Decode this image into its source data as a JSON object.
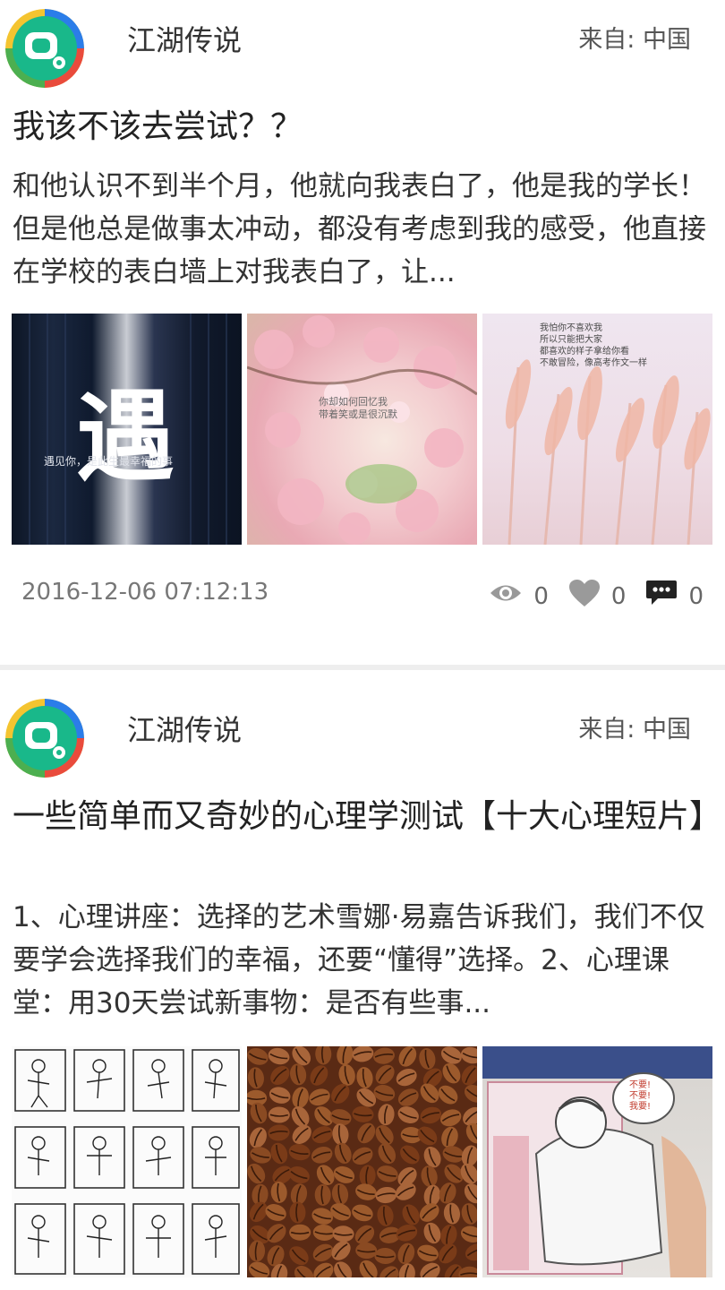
{
  "posts": [
    {
      "author": "江湖传说",
      "origin": "来自: 中国",
      "title": "我该不该去尝试？？",
      "body": "和他认识不到半个月，他就向我表白了，他是我的学长！但是他总是做事太冲动，都没有考虑到我的感受，他直接在学校的表白墙上对我表白了，让...",
      "images": [
        {
          "icon": "encounter-image",
          "caption": "遇",
          "subcaption": "遇见你，是此生最幸福的事"
        },
        {
          "icon": "blossom-image",
          "caption": "你却如何回忆我\n带着笑或是很沉默"
        },
        {
          "icon": "reeds-image",
          "caption": "我怕你不喜欢我\n所以只能把大家\n都喜欢的样子拿给你看\n不敢冒险，像高考作文一样"
        }
      ],
      "date": "2016-12-06 07:12:13",
      "views": "0",
      "likes": "0",
      "comments": "0"
    },
    {
      "author": "江湖传说",
      "origin": "来自: 中国",
      "title": "一些简单而又奇妙的心理学测试【十大心理短片】",
      "body": "1、心理讲座：选择的艺术雪娜·易嘉告诉我们，我们不仅要学会选择我们的幸福，还要“懂得”选择。2、心理课堂：用30天尝试新事物：是否有些事...",
      "images": [
        {
          "icon": "sleeping-poses-image",
          "caption": ""
        },
        {
          "icon": "coffee-beans-image",
          "caption": ""
        },
        {
          "icon": "drawing-image",
          "caption": "不要!\n不要!\n我要!"
        }
      ]
    }
  ],
  "colors": {
    "avatarGreen": "#19b88a",
    "accentBlue": "#2b7de9",
    "iconGray": "#999999"
  }
}
